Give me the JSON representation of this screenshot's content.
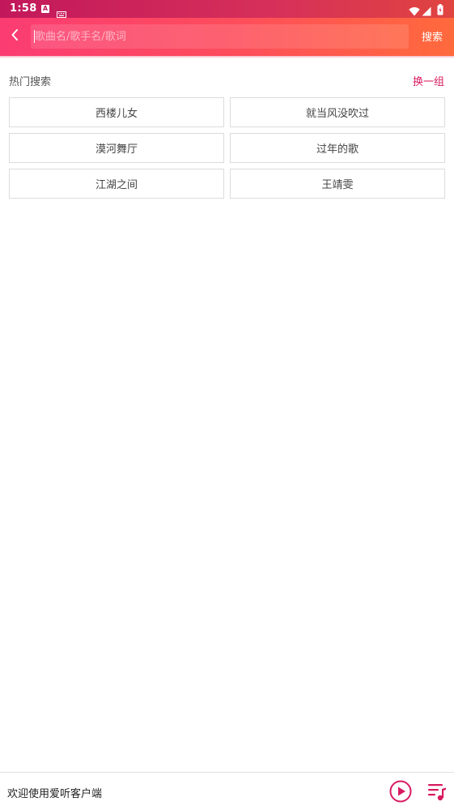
{
  "status_bar": {
    "time": "1:58",
    "icons": [
      "a-notification-icon",
      "keyboard-icon",
      "wifi-icon",
      "signal-icon",
      "battery-icon"
    ]
  },
  "search": {
    "placeholder": "歌曲名/歌手名/歌词",
    "value": "",
    "button_label": "搜索",
    "back_icon": "chevron-left-icon"
  },
  "hot_search": {
    "title": "热门搜索",
    "refresh_label": "换一组",
    "items": [
      "西楼儿女",
      "就当风没吹过",
      "漠河舞厅",
      "过年的歌",
      "江湖之间",
      "王靖雯"
    ]
  },
  "player": {
    "text": "欢迎使用爱听客户端",
    "play_icon": "play-circle-icon",
    "playlist_icon": "playlist-music-icon"
  },
  "colors": {
    "header_gradient_start": "#fb3c73",
    "header_gradient_end": "#ff6a3c",
    "status_bar": "#c2185b",
    "accent": "#d81b60"
  }
}
